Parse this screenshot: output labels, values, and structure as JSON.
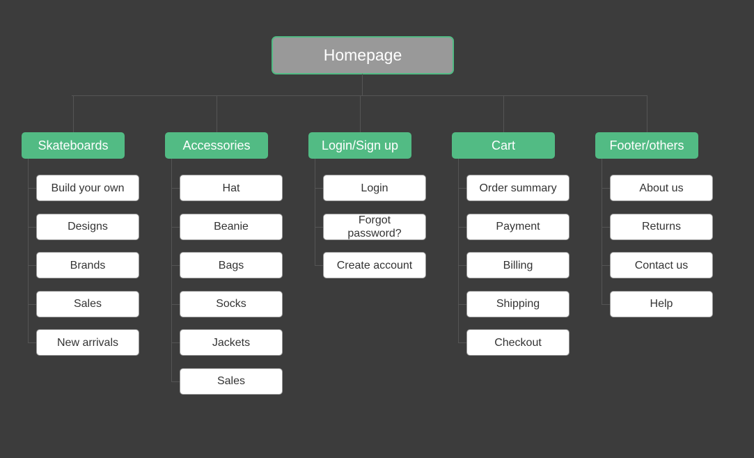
{
  "colors": {
    "background": "#3c3c3c",
    "root_fill": "#999999",
    "category_fill": "#52bb84",
    "item_fill": "#ffffff",
    "connector": "#555555"
  },
  "root": {
    "label": "Homepage"
  },
  "categories": [
    {
      "label": "Skateboards",
      "items": [
        "Build your own",
        "Designs",
        "Brands",
        "Sales",
        "New arrivals"
      ]
    },
    {
      "label": "Accessories",
      "items": [
        "Hat",
        "Beanie",
        "Bags",
        "Socks",
        "Jackets",
        "Sales"
      ]
    },
    {
      "label": "Login/Sign up",
      "items": [
        "Login",
        "Forgot password?",
        "Create account"
      ]
    },
    {
      "label": "Cart",
      "items": [
        "Order summary",
        "Payment",
        "Billing",
        "Shipping",
        "Checkout"
      ]
    },
    {
      "label": "Footer/others",
      "items": [
        "About us",
        "Returns",
        "Contact us",
        "Help"
      ]
    }
  ]
}
